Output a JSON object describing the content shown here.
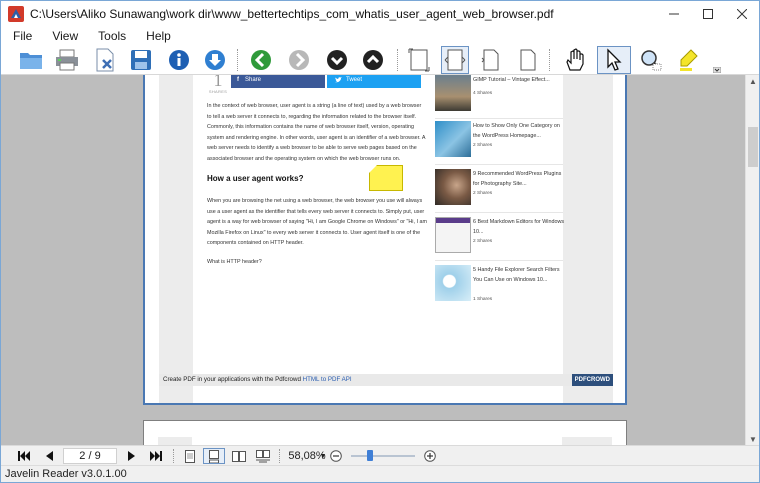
{
  "window": {
    "title": "C:\\Users\\Aliko Sunawang\\work dir\\www_bettertechtips_com_whatis_user_agent_web_browser.pdf"
  },
  "menu": [
    "File",
    "View",
    "Tools",
    "Help"
  ],
  "toolbar_icons": [
    "open-folder-icon",
    "print-icon",
    "close-document-icon",
    "save-icon",
    "info-icon",
    "download-icon",
    "back-icon",
    "forward-icon",
    "previous-page-icon",
    "next-page-icon",
    "fit-page-icon",
    "fit-width-icon",
    "single-page-icon",
    "two-page-icon",
    "hand-tool-icon",
    "select-tool-icon",
    "search-comment-icon",
    "highlighter-icon"
  ],
  "page": {
    "share_count": "1",
    "shares_label": "SHARES",
    "facebook_label": "Share",
    "tweet_label": "Tweet",
    "paragraph1": "In the context of web browser, user agent is a string (a line of text) used by a web browser to tell a web server it connects to, regarding the information related to the browser itself. Commonly, this information contains the name of web browser itself, version, operating system and rendering engine. In other words, user agent is an identifier of a web browser. A web server needs to identify a web browser to be able to serve web pages based on the associated browser and the operating system on which the web browser runs on.",
    "heading": "How a user agent works?",
    "paragraph2": "When you are browsing the net using a web browser, the web browser you use will always use a user agent as the identifier that tells every web server it connects to. Simply put, user agent is a way for web browser of saying \"Hi, I am Google Chrome on Windows\" or \"Hi, I am Mozilla Firefox on Linux\" to every web server it connects to. User agent itself is one of the components contained on HTTP header.",
    "paragraph3": "What is HTTP header?",
    "sidebar": [
      {
        "title": "GIMP Tutorial – Vintage Effect...",
        "shares": "4 Shares"
      },
      {
        "title": "How to Show Only One Category on the WordPress Homepage...",
        "shares": "2 Shares"
      },
      {
        "title": "9 Recommended WordPress Plugins for Photography Site...",
        "shares": "2 Shares"
      },
      {
        "title": "6 Best Markdown Editors for Windows 10...",
        "shares": "2 Shares"
      },
      {
        "title": "5 Handy File Explorer Search Filters You Can Use on Windows 10...",
        "shares": "1 Shares"
      }
    ],
    "footer_text": "Create PDF in your applications with the Pdfcrowd",
    "footer_link": "HTML to PDF API",
    "footer_logo": "PDFCROWD"
  },
  "status": {
    "page_indicator": "2 / 9",
    "zoom": "58,08%",
    "zoom_level": 0.3
  },
  "bottom": {
    "version": "Javelin Reader v3.0.1.00"
  }
}
